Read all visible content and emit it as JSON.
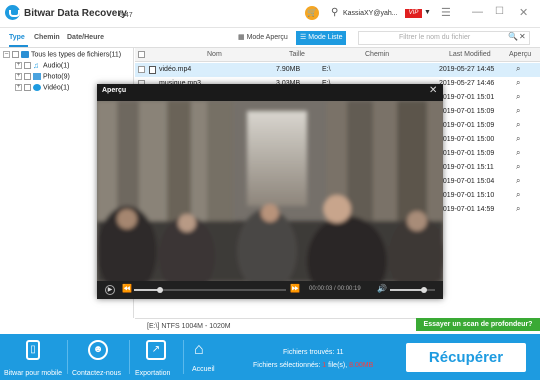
{
  "app": {
    "title": "Bitwar Data Recovery",
    "version": "6.47",
    "user": "KassiaXY@yah...",
    "vip": "VIP"
  },
  "toolbar": {
    "tabs": [
      "Type",
      "Chemin",
      "Date/Heure"
    ],
    "mode_preview": "Mode Aperçu",
    "mode_list": "Mode Liste",
    "search_placeholder": "Filtrer le nom du fichier"
  },
  "tree": {
    "root": "Tous les types de fichiers(11)",
    "items": [
      "Audio(1)",
      "Photo(9)",
      "Vidéo(1)"
    ]
  },
  "table": {
    "headers": [
      "Nom",
      "Taille",
      "Chemin",
      "Last Modified",
      "Aperçu"
    ],
    "rows": [
      {
        "name": "vidéo.mp4",
        "size": "7.90MB",
        "path": "E:\\",
        "modified": "2019-05-27  14:45"
      },
      {
        "name": "musique.mp3",
        "size": "3.03MB",
        "path": "E:\\",
        "modified": "2019-05-27  14:46"
      },
      {
        "name": "",
        "size": "",
        "path": "",
        "modified": "2019-07-01  15:01"
      },
      {
        "name": "",
        "size": "",
        "path": "",
        "modified": "2019-07-01  15:09"
      },
      {
        "name": "",
        "size": "",
        "path": "",
        "modified": "2019-07-01  15:09"
      },
      {
        "name": "",
        "size": "",
        "path": "",
        "modified": "2019-07-01  15:00"
      },
      {
        "name": "",
        "size": "",
        "path": "",
        "modified": "2019-07-01  15:09"
      },
      {
        "name": "",
        "size": "",
        "path": "",
        "modified": "2019-07-01  15:11"
      },
      {
        "name": "",
        "size": "",
        "path": "",
        "modified": "2019-07-01  15:04"
      },
      {
        "name": "",
        "size": "",
        "path": "",
        "modified": "2019-07-01  15:10"
      },
      {
        "name": "",
        "size": "",
        "path": "",
        "modified": "2019-07-01  14:59"
      }
    ]
  },
  "preview": {
    "title": "Aperçu",
    "time": "00:00:03 / 00:00:19",
    "progress": 0.17,
    "volume": 0.75
  },
  "footer": {
    "partition": "[E:\\] NTFS 1004M - 1020M",
    "deep_scan": "Essayer un scan de profondeur?",
    "found_label": "Fichiers trouvés:",
    "found_count": "11",
    "selected_label": "Fichiers sélectionnés:",
    "selected_files": "1",
    "selected_files_suffix": "file(s),",
    "selected_size": "8.00MB",
    "recover": "Récupérer"
  },
  "bottom": {
    "buttons": [
      "Bitwar pour mobile",
      "Contactez-nous",
      "Exportation",
      "Accueil"
    ]
  },
  "colors": {
    "accent": "#1e9be0",
    "deep_scan": "#3aaa35",
    "vip": "#e02020",
    "cart": "#f5a623"
  }
}
